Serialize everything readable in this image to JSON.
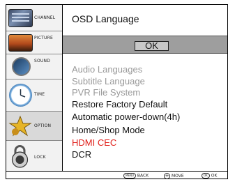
{
  "sidebar": {
    "items": [
      {
        "label": "CHANNEL",
        "icon": "channel-icon"
      },
      {
        "label": "PICTURE",
        "icon": "picture-icon"
      },
      {
        "label": "SOUND",
        "icon": "sound-icon"
      },
      {
        "label": "TIME",
        "icon": "time-icon"
      },
      {
        "label": "OPTION",
        "icon": "option-icon"
      },
      {
        "label": "LOCK",
        "icon": "lock-icon"
      }
    ]
  },
  "header": {
    "title": "OSD Language"
  },
  "ok_button": {
    "label": "OK"
  },
  "menu": {
    "items": [
      {
        "label": "Audio Languages",
        "state": "disabled"
      },
      {
        "label": "Subtitle Language",
        "state": "disabled"
      },
      {
        "label": "PVR File System",
        "state": "disabled"
      },
      {
        "label": "Restore Factory Default",
        "state": "normal"
      },
      {
        "label": "Automatic power-down(4h)",
        "state": "normal"
      },
      {
        "label": "Home/Shop Mode",
        "state": "normal"
      },
      {
        "label": "HDMI CEC",
        "state": "highlight"
      },
      {
        "label": "DCR",
        "state": "normal"
      }
    ]
  },
  "footer": {
    "back": {
      "key": "MENU",
      "label": "BACK"
    },
    "move": {
      "key": "+",
      "label": "MOVE"
    },
    "ok": {
      "key": "OK",
      "label": "OK"
    }
  },
  "colors": {
    "highlight": "#e0201b",
    "disabled": "#9a9a9a",
    "ok_row": "#9e9e9e"
  }
}
